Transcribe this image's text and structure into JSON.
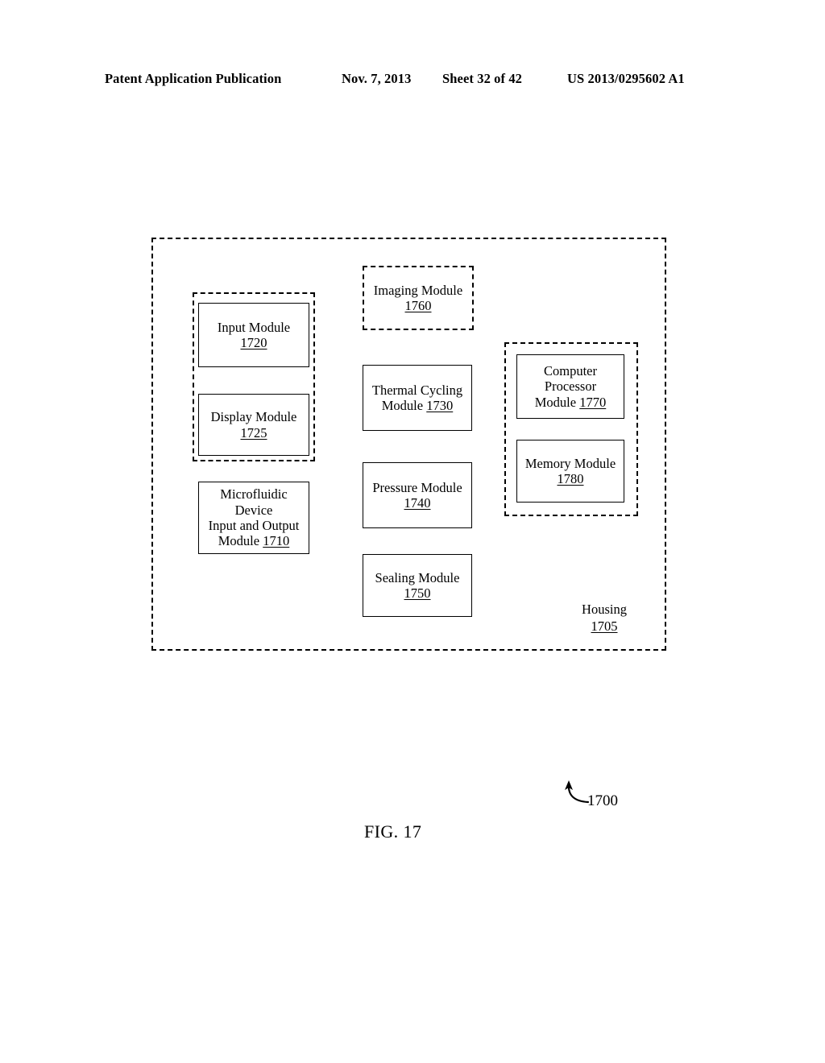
{
  "header": {
    "publication": "Patent Application Publication",
    "date": "Nov. 7, 2013",
    "sheet": "Sheet 32 of 42",
    "patent_number": "US 2013/0295602 A1"
  },
  "figure": {
    "caption": "FIG. 17",
    "leader_label": "1700",
    "housing": {
      "label": "Housing",
      "ref": "1705"
    },
    "modules": {
      "input": {
        "line1": "Input Module",
        "ref": "1720"
      },
      "display": {
        "line1": "Display Module",
        "ref": "1725"
      },
      "microfluidic": {
        "line1": "Microfluidic",
        "line2": "Device",
        "line3": "Input and Output",
        "line4": "Module ",
        "ref": "1710"
      },
      "imaging": {
        "line1": "Imaging Module",
        "ref": "1760"
      },
      "thermal_cycling": {
        "line1": "Thermal Cycling",
        "line2": "Module ",
        "ref": "1730"
      },
      "pressure": {
        "line1": "Pressure Module",
        "ref": "1740"
      },
      "sealing": {
        "line1": "Sealing Module",
        "ref": "1750"
      },
      "computer_processor": {
        "line1": "Computer",
        "line2": "Processor",
        "line3": "Module ",
        "ref": "1770"
      },
      "memory": {
        "line1": "Memory Module",
        "ref": "1780"
      }
    }
  }
}
